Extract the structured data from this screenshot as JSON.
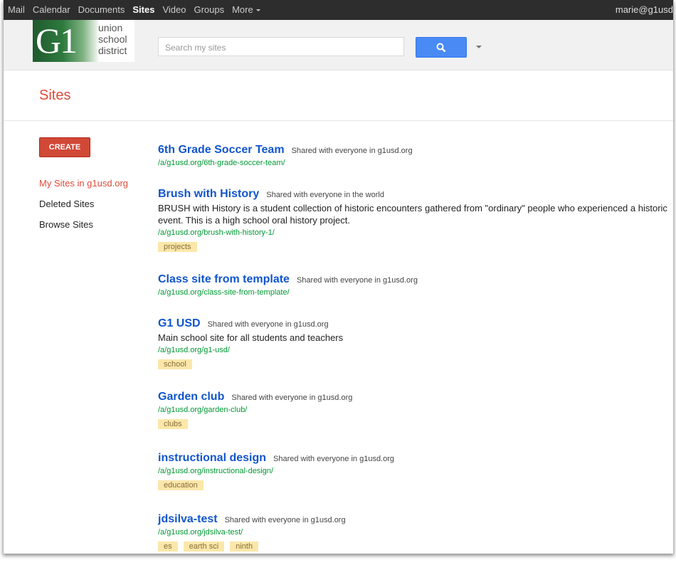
{
  "gbar": {
    "items": [
      "Mail",
      "Calendar",
      "Documents",
      "Sites",
      "Video",
      "Groups",
      "More"
    ],
    "user": "marie@g1usd"
  },
  "logo": {
    "mark": "G1",
    "line1": "union",
    "line2": "school",
    "line3": "district"
  },
  "search": {
    "placeholder": "Search my sites"
  },
  "page": {
    "title": "Sites"
  },
  "sidebar": {
    "create_label": "CREATE",
    "items": [
      {
        "label": "My Sites in g1usd.org"
      },
      {
        "label": "Deleted Sites"
      },
      {
        "label": "Browse Sites"
      }
    ]
  },
  "sites": [
    {
      "name": "6th Grade Soccer Team",
      "share": "Shared with everyone in g1usd.org",
      "desc": "",
      "url": "/a/g1usd.org/6th-grade-soccer-team/",
      "tags": []
    },
    {
      "name": "Brush with History",
      "share": "Shared with everyone in the world",
      "desc": "BRUSH with History is a student collection of historic encounters gathered from \"ordinary\" people who experienced a historic event. This is a high school oral history project.",
      "url": "/a/g1usd.org/brush-with-history-1/",
      "tags": [
        "projects"
      ]
    },
    {
      "name": "Class site from template",
      "share": "Shared with everyone in g1usd.org",
      "desc": "",
      "url": "/a/g1usd.org/class-site-from-template/",
      "tags": []
    },
    {
      "name": "G1 USD",
      "share": "Shared with everyone in g1usd.org",
      "desc": "Main school site for all students and teachers",
      "url": "/a/g1usd.org/g1-usd/",
      "tags": [
        "school"
      ]
    },
    {
      "name": "Garden club",
      "share": "Shared with everyone in g1usd.org",
      "desc": "",
      "url": "/a/g1usd.org/garden-club/",
      "tags": [
        "clubs"
      ]
    },
    {
      "name": "instructional design",
      "share": "Shared with everyone in g1usd.org",
      "desc": "",
      "url": "/a/g1usd.org/instructional-design/",
      "tags": [
        "education"
      ]
    },
    {
      "name": "jdsilva-test",
      "share": "Shared with everyone in g1usd.org",
      "desc": "",
      "url": "/a/g1usd.org/jdsilva-test/",
      "tags": [
        "es",
        "earth sci",
        "ninth"
      ]
    }
  ]
}
